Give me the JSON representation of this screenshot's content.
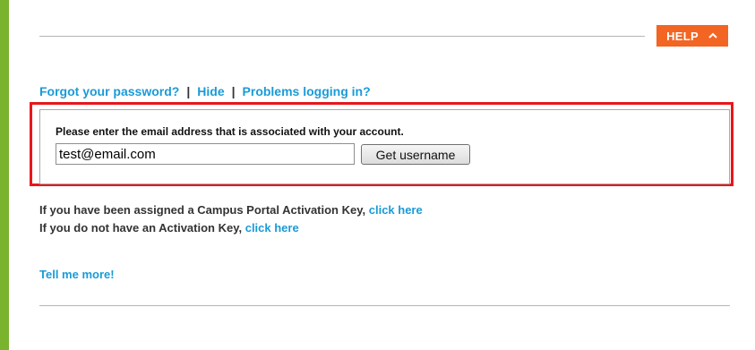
{
  "colors": {
    "accent_green": "#7ab32e",
    "help_orange": "#f26522",
    "link_blue": "#1a9bd7",
    "highlight_red": "#e8161b"
  },
  "help": {
    "label": "HELP",
    "icon": "chevron-up-icon"
  },
  "links": {
    "forgot_password": "Forgot your password?",
    "separator": "|",
    "hide": "Hide",
    "problems": "Problems logging in?"
  },
  "username_form": {
    "prompt": "Please enter the email address that is associated with your account.",
    "email_value": "test@email.com",
    "submit_label": "Get username"
  },
  "activation": {
    "assigned_text": "If you have been assigned a Campus Portal Activation Key,",
    "assigned_link": "click here",
    "no_key_text": "If you do not have an Activation Key,",
    "no_key_link": "click here"
  },
  "tell_more": "Tell me more!"
}
